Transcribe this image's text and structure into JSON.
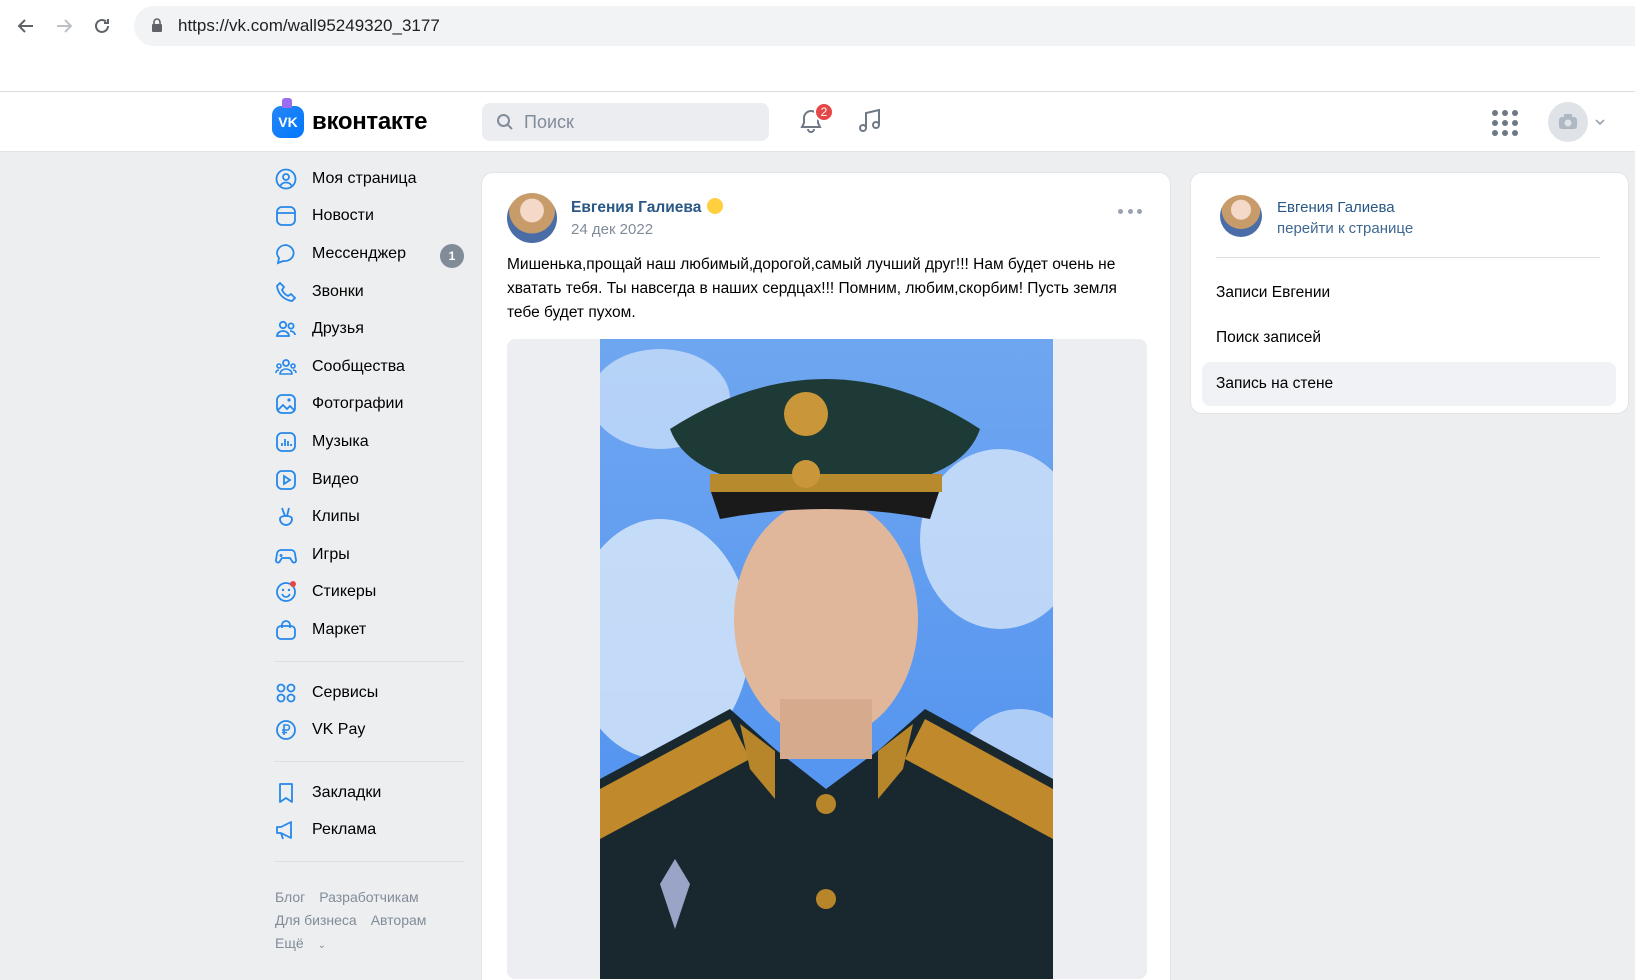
{
  "browser": {
    "url": "https://vk.com/wall95249320_3177"
  },
  "header": {
    "logo_text": "вконтакте",
    "search_placeholder": "Поиск",
    "notifications_count": "2"
  },
  "sidebar": {
    "items": [
      {
        "label": "Моя страница",
        "icon": "user-circle-icon"
      },
      {
        "label": "Новости",
        "icon": "news-icon"
      },
      {
        "label": "Мессенджер",
        "icon": "message-icon",
        "count": "1"
      },
      {
        "label": "Звонки",
        "icon": "phone-icon"
      },
      {
        "label": "Друзья",
        "icon": "friends-icon"
      },
      {
        "label": "Сообщества",
        "icon": "communities-icon"
      },
      {
        "label": "Фотографии",
        "icon": "photo-icon"
      },
      {
        "label": "Музыка",
        "icon": "music-icon"
      },
      {
        "label": "Видео",
        "icon": "video-icon"
      },
      {
        "label": "Клипы",
        "icon": "clips-icon"
      },
      {
        "label": "Игры",
        "icon": "gamepad-icon"
      },
      {
        "label": "Стикеры",
        "icon": "sticker-icon"
      },
      {
        "label": "Маркет",
        "icon": "market-icon"
      }
    ],
    "items2": [
      {
        "label": "Сервисы",
        "icon": "services-icon"
      },
      {
        "label": "VK Pay",
        "icon": "vkpay-icon"
      }
    ],
    "items3": [
      {
        "label": "Закладки",
        "icon": "bookmark-icon"
      },
      {
        "label": "Реклама",
        "icon": "megaphone-icon"
      }
    ],
    "footer": {
      "blog": "Блог",
      "developers": "Разработчикам",
      "business": "Для бизнеса",
      "authors": "Авторам",
      "more": "Ещё"
    }
  },
  "post": {
    "author": "Евгения Галиева",
    "date": "24 дек 2022",
    "text": "Мишенька,прощай наш любимый,дорогой,самый лучший друг!!! Нам будет очень не хватать тебя. Ты навсегда в наших сердцах!!! Помним, любим,скорбим! Пусть земля тебе будет пухом."
  },
  "side_panel": {
    "name": "Евгения Галиева",
    "link": "перейти к странице",
    "items": [
      "Записи Евгении",
      "Поиск записей",
      "Запись на стене"
    ],
    "active_index": 2
  },
  "colors": {
    "link": "#2a5885",
    "accent": "#0077ff",
    "badge": "#e64646",
    "background": "#edeef0"
  }
}
